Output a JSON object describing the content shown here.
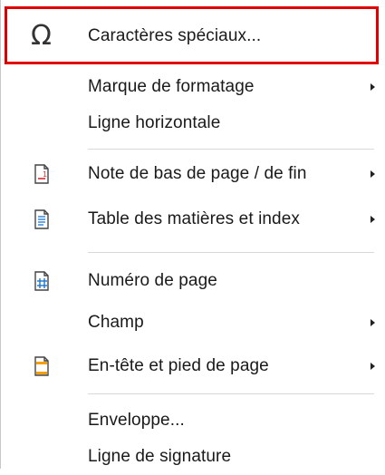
{
  "menu": {
    "items": [
      {
        "label": "Caractères spéciaux...",
        "icon": "omega-icon",
        "submenu": false,
        "highlighted": true
      },
      {
        "label": "Marque de formatage",
        "submenu": true
      },
      {
        "label": "Ligne horizontale",
        "submenu": false
      },
      {
        "label": "Note de bas de page / de fin",
        "icon": "footnote-icon",
        "submenu": true
      },
      {
        "label": "Table des matières et index",
        "icon": "table-of-contents-icon",
        "submenu": true
      },
      {
        "label": "Numéro de page",
        "icon": "page-number-icon",
        "submenu": false
      },
      {
        "label": "Champ",
        "submenu": true
      },
      {
        "label": "En-tête et pied de page",
        "icon": "header-footer-icon",
        "submenu": true
      },
      {
        "label": "Enveloppe...",
        "submenu": false
      },
      {
        "label": "Ligne de signature",
        "submenu": false
      }
    ],
    "highlight_color": "#e00000",
    "icon_accent_red": "#d32f2f",
    "icon_accent_blue": "#1976d2",
    "icon_accent_orange": "#f59e0b"
  }
}
